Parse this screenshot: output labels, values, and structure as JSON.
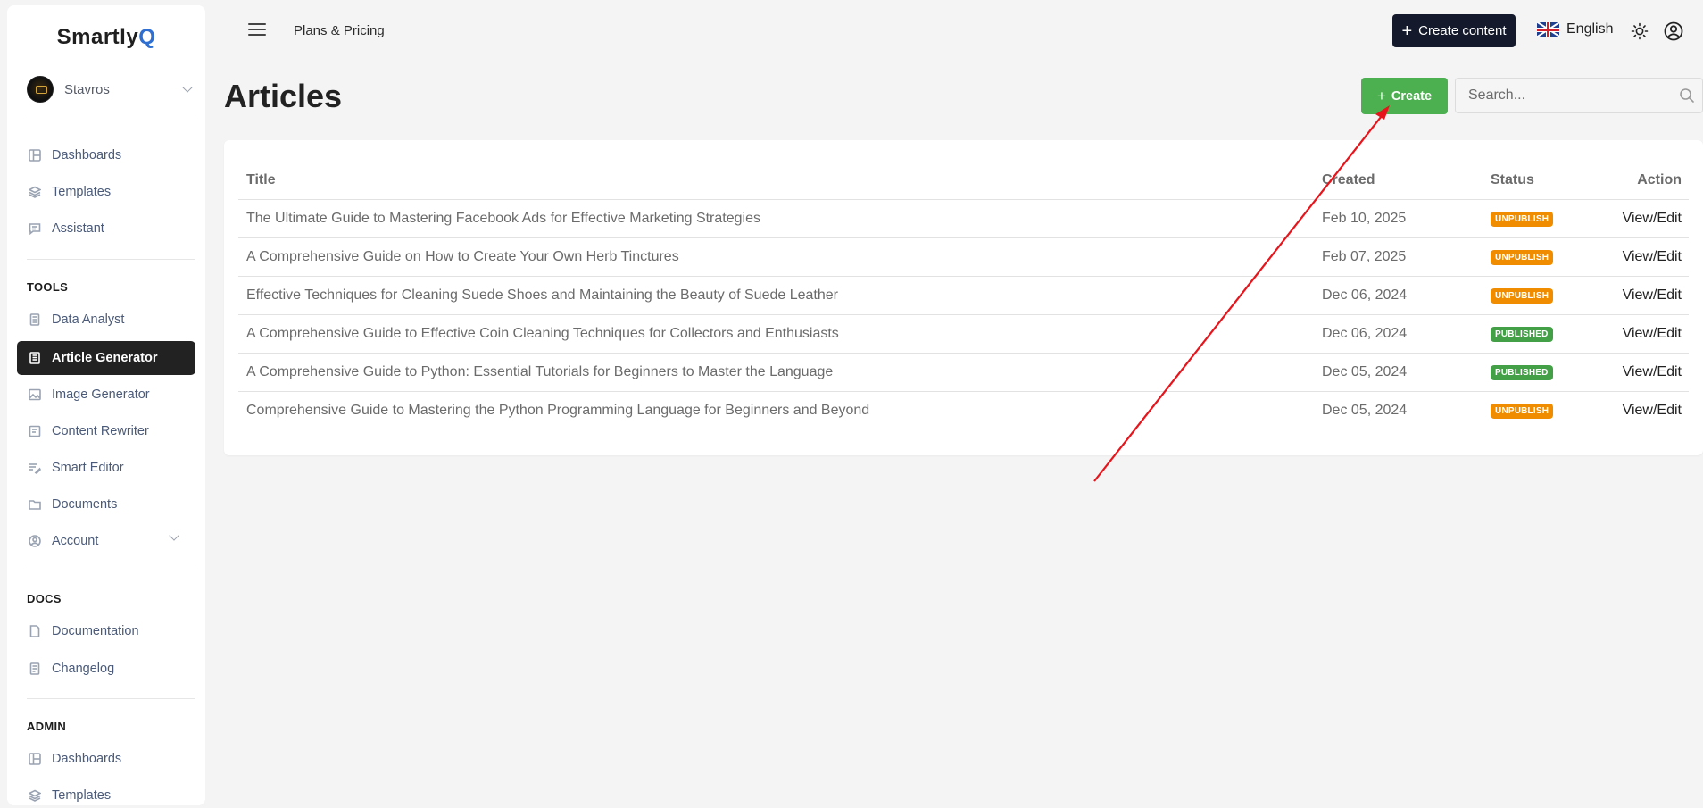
{
  "brand": {
    "name_main": "Smartly",
    "name_accent": "Q"
  },
  "user": {
    "name": "Stavros"
  },
  "sidebar": {
    "main_items": [
      {
        "label": "Dashboards",
        "icon": "dashboard-icon"
      },
      {
        "label": "Templates",
        "icon": "layers-icon"
      },
      {
        "label": "Assistant",
        "icon": "chat-icon"
      }
    ],
    "tools_title": "TOOLS",
    "tools_items": [
      {
        "label": "Data Analyst",
        "icon": "database-icon"
      },
      {
        "label": "Article Generator",
        "icon": "document-icon",
        "active": true
      },
      {
        "label": "Image Generator",
        "icon": "image-icon"
      },
      {
        "label": "Content Rewriter",
        "icon": "rewrite-icon"
      },
      {
        "label": "Smart Editor",
        "icon": "edit-icon"
      },
      {
        "label": "Documents",
        "icon": "folder-icon"
      },
      {
        "label": "Account",
        "icon": "user-icon"
      }
    ],
    "docs_title": "DOCS",
    "docs_items": [
      {
        "label": "Documentation",
        "icon": "file-icon"
      },
      {
        "label": "Changelog",
        "icon": "changelog-icon"
      }
    ],
    "admin_title": "ADMIN",
    "admin_items": [
      {
        "label": "Dashboards",
        "icon": "dashboard-icon"
      },
      {
        "label": "Templates",
        "icon": "layers-icon"
      }
    ]
  },
  "topbar": {
    "plans_link": "Plans & Pricing",
    "create_content_label": "Create content",
    "language": "English"
  },
  "page": {
    "title": "Articles",
    "create_label": "Create",
    "search_placeholder": "Search..."
  },
  "table": {
    "headers": {
      "title": "Title",
      "created": "Created",
      "status": "Status",
      "action": "Action"
    },
    "rows": [
      {
        "title": "The Ultimate Guide to Mastering Facebook Ads for Effective Marketing Strategies",
        "created": "Feb 10, 2025",
        "status": "UNPUBLISH",
        "action": "View/Edit"
      },
      {
        "title": "A Comprehensive Guide on How to Create Your Own Herb Tinctures",
        "created": "Feb 07, 2025",
        "status": "UNPUBLISH",
        "action": "View/Edit"
      },
      {
        "title": "Effective Techniques for Cleaning Suede Shoes and Maintaining the Beauty of Suede Leather",
        "created": "Dec 06, 2024",
        "status": "UNPUBLISH",
        "action": "View/Edit"
      },
      {
        "title": "A Comprehensive Guide to Effective Coin Cleaning Techniques for Collectors and Enthusiasts",
        "created": "Dec 06, 2024",
        "status": "PUBLISHED",
        "action": "View/Edit"
      },
      {
        "title": "A Comprehensive Guide to Python: Essential Tutorials for Beginners to Master the Language",
        "created": "Dec 05, 2024",
        "status": "PUBLISHED",
        "action": "View/Edit"
      },
      {
        "title": "Comprehensive Guide to Mastering the Python Programming Language for Beginners and Beyond",
        "created": "Dec 05, 2024",
        "status": "UNPUBLISH",
        "action": "View/Edit"
      }
    ]
  },
  "colors": {
    "create_button": "#4caf50",
    "create_content_button": "#141a2b",
    "unpublish_badge": "#f08c00",
    "published_badge": "#43a047",
    "annotation_arrow": "#e8141c"
  }
}
